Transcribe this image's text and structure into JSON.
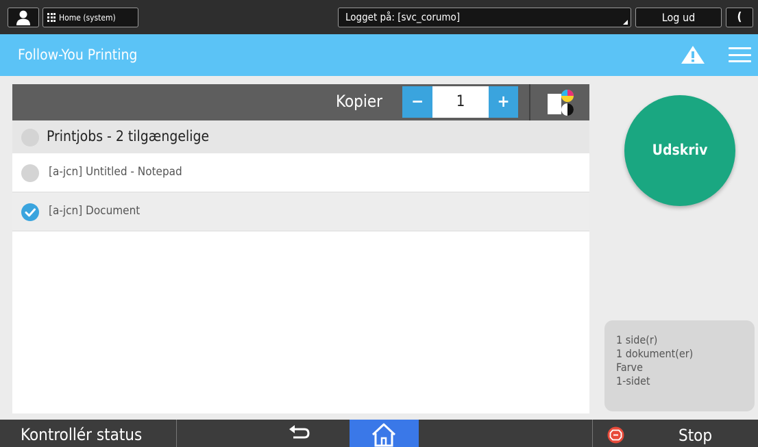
{
  "topbar": {
    "user_icon": "user-icon",
    "home_system_label": "Home (system)",
    "logged_in_label": "Logget på: [svc_corumo]",
    "logout_label": "Log ud",
    "moon_glyph": "(",
    "moon_icon": "moon-icon"
  },
  "titlebar": {
    "title": "Follow-You Printing",
    "warning_icon": "warning-icon",
    "menu_icon": "hamburger-menu-icon",
    "background": "#5bc3f6"
  },
  "copies": {
    "label": "Kopier",
    "minus": "−",
    "value": "1",
    "plus": "+",
    "color_mode_icon": "color-mode-icon"
  },
  "joblist": {
    "header": "Printjobs - 2 tilgængelige",
    "jobs": [
      {
        "label": "[a-jcn] Untitled - Notepad",
        "selected": false
      },
      {
        "label": "[a-jcn] Document",
        "selected": true
      }
    ]
  },
  "print_button": {
    "label": "Udskriv",
    "color": "#1aa781"
  },
  "summary": {
    "pages": "1 side(r)",
    "documents": "1 dokument(er)",
    "color": "Farve",
    "sides": "1-sidet"
  },
  "bottombar": {
    "status_label": "Kontrollér status",
    "back_icon": "back-arrow-icon",
    "home_icon": "home-icon",
    "stop_icon": "stop-icon",
    "stop_label": "Stop"
  },
  "colors": {
    "accent_blue": "#3aa4de",
    "home_blue": "#3a78e8",
    "stop_red": "#e84a3a"
  }
}
